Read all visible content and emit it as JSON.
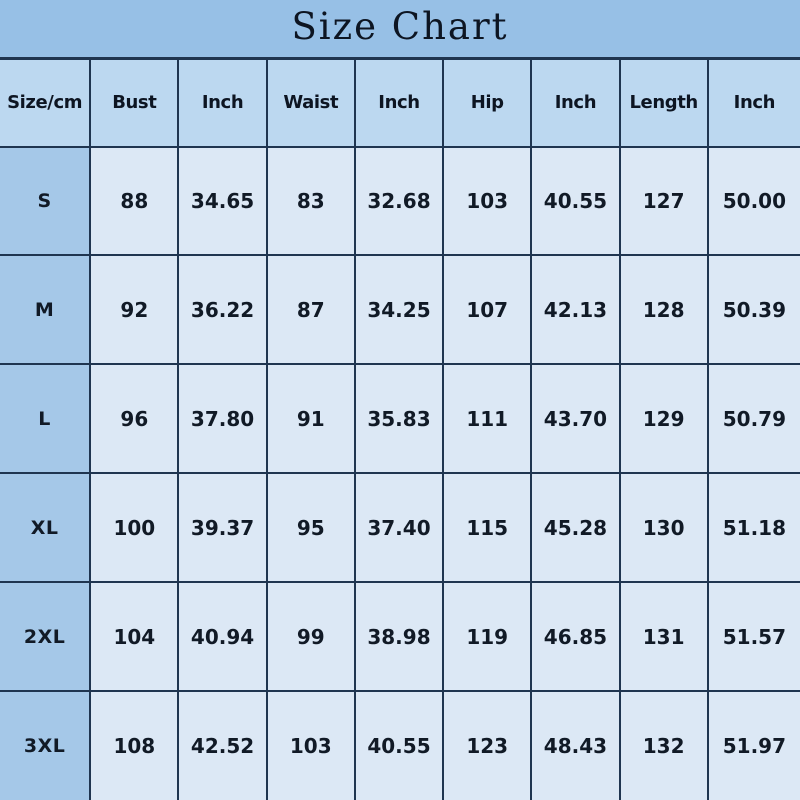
{
  "title": "Size Chart",
  "table": {
    "columns": [
      "Size/cm",
      "Bust",
      "Inch",
      "Waist",
      "Inch",
      "Hip",
      "Inch",
      "Length",
      "Inch"
    ],
    "rows": [
      {
        "size": "S",
        "bust_cm": "88",
        "bust_in": "34.65",
        "waist_cm": "83",
        "waist_in": "32.68",
        "hip_cm": "103",
        "hip_in": "40.55",
        "length_cm": "127",
        "length_in": "50.00"
      },
      {
        "size": "M",
        "bust_cm": "92",
        "bust_in": "36.22",
        "waist_cm": "87",
        "waist_in": "34.25",
        "hip_cm": "107",
        "hip_in": "42.13",
        "length_cm": "128",
        "length_in": "50.39"
      },
      {
        "size": "L",
        "bust_cm": "96",
        "bust_in": "37.80",
        "waist_cm": "91",
        "waist_in": "35.83",
        "hip_cm": "111",
        "hip_in": "43.70",
        "length_cm": "129",
        "length_in": "50.79"
      },
      {
        "size": "XL",
        "bust_cm": "100",
        "bust_in": "39.37",
        "waist_cm": "95",
        "waist_in": "37.40",
        "hip_cm": "115",
        "hip_in": "45.28",
        "length_cm": "130",
        "length_in": "51.18"
      },
      {
        "size": "2XL",
        "bust_cm": "104",
        "bust_in": "40.94",
        "waist_cm": "99",
        "waist_in": "38.98",
        "hip_cm": "119",
        "hip_in": "46.85",
        "length_cm": "131",
        "length_in": "51.57"
      },
      {
        "size": "3XL",
        "bust_cm": "108",
        "bust_in": "42.52",
        "waist_cm": "103",
        "waist_in": "40.55",
        "hip_cm": "123",
        "hip_in": "48.43",
        "length_cm": "132",
        "length_in": "51.97"
      }
    ]
  },
  "colors": {
    "title_banner": "#97c0e6",
    "header_row": "#bcd8f0",
    "size_column": "#a5c8e8",
    "data_cell": "#dce8f5",
    "border": "#1f3550",
    "text": "#0d1522"
  },
  "chart_data": {
    "type": "table",
    "title": "Size Chart",
    "columns": [
      "Size/cm",
      "Bust",
      "Inch",
      "Waist",
      "Inch",
      "Hip",
      "Inch",
      "Length",
      "Inch"
    ],
    "rows": [
      [
        "S",
        "88",
        "34.65",
        "83",
        "32.68",
        "103",
        "40.55",
        "127",
        "50.00"
      ],
      [
        "M",
        "92",
        "36.22",
        "87",
        "34.25",
        "107",
        "42.13",
        "128",
        "50.39"
      ],
      [
        "L",
        "96",
        "37.80",
        "91",
        "35.83",
        "111",
        "43.70",
        "129",
        "50.79"
      ],
      [
        "XL",
        "100",
        "39.37",
        "95",
        "37.40",
        "115",
        "45.28",
        "130",
        "51.18"
      ],
      [
        "2XL",
        "104",
        "40.94",
        "99",
        "38.98",
        "119",
        "46.85",
        "131",
        "51.57"
      ],
      [
        "3XL",
        "108",
        "42.52",
        "103",
        "40.55",
        "123",
        "48.43",
        "132",
        "51.97"
      ]
    ]
  }
}
